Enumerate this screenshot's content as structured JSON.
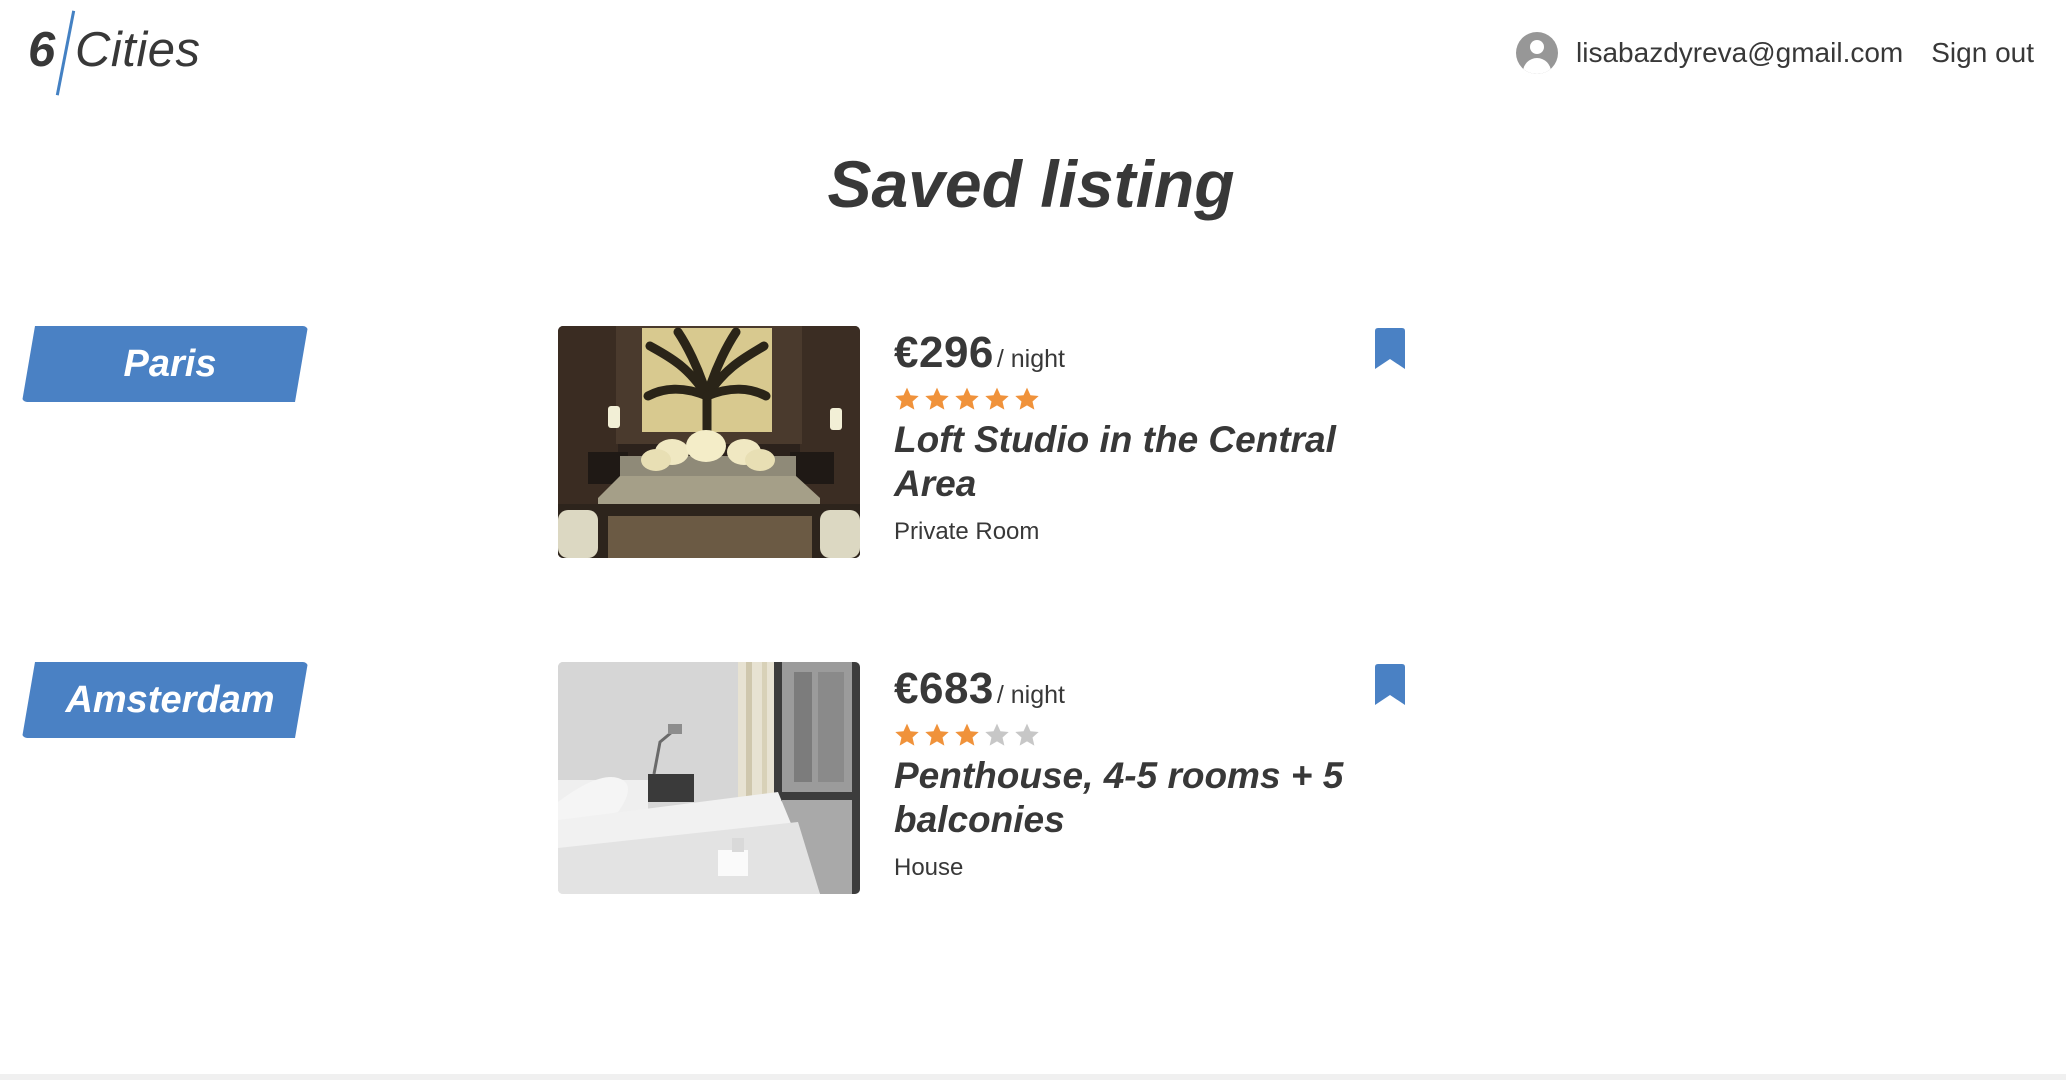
{
  "header": {
    "logo": {
      "number": "6",
      "word": "Cities",
      "accent": "#4481c3"
    },
    "user": {
      "email": "lisabazdyreva@gmail.com",
      "avatar_icon": "user-avatar-icon"
    },
    "signout_label": "Sign out"
  },
  "main": {
    "title": "Saved listing",
    "groups": [
      {
        "city": "Paris",
        "offers": [
          {
            "price": "€296",
            "price_unit": "/ night",
            "rating": 5,
            "max_rating": 5,
            "name": "Loft Studio in the Central Area",
            "type": "Private Room",
            "bookmarked": true
          }
        ]
      },
      {
        "city": "Amsterdam",
        "offers": [
          {
            "price": "€683",
            "price_unit": "/ night",
            "rating": 3,
            "max_rating": 5,
            "name": "Penthouse, 4-5 rooms + 5 balconies",
            "type": "House",
            "bookmarked": true
          }
        ]
      }
    ]
  },
  "colors": {
    "accent": "#4a81c4",
    "star_filled": "#f0923a",
    "star_empty": "#c7c7c7",
    "text": "#383838"
  }
}
